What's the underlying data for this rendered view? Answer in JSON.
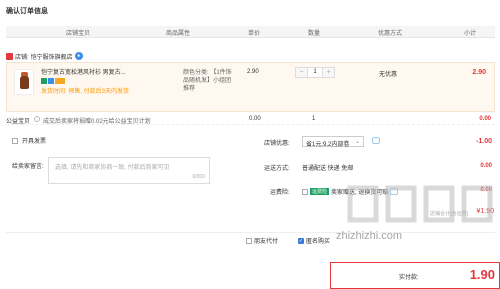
{
  "page_title": "确认订单信息",
  "table_headers": {
    "shop_item": "店铺宝贝",
    "attr": "商品属性",
    "unit_price": "单价",
    "qty": "数量",
    "discount": "优惠方式",
    "subtotal": "小计"
  },
  "shop": {
    "label": "店铺:",
    "name": "恺宁服饰旗舰店"
  },
  "item": {
    "name": "恺宁复古宽松港风衬衫 男复古",
    "name_cont": "...",
    "promo": "发货时间: 预售, 付款后3天内发货",
    "attr": "颜色分类: 【1件饰品随机发】小组团推荐",
    "price": "2.90",
    "qty": "1",
    "minus": "−",
    "plus": "+",
    "discount": "无优惠",
    "subtotal": "2.90"
  },
  "charity": {
    "label": "公益宝贝",
    "text": "成交后卖家将捐赠0.02元给公益宝贝计划",
    "price": "0.00",
    "qty": "1",
    "subtotal": "0.00"
  },
  "invoice_label": "开具发票",
  "message": {
    "label": "给卖家留言:",
    "placeholder": "选填, 请先和商家协商一致, 付款后商家可见",
    "counter": "0/200"
  },
  "store_discount": {
    "label": "店铺优惠:",
    "value": "省1元:9.2内部卷",
    "amount": "-1.00"
  },
  "shipping": {
    "label": "运送方式:",
    "value": "普通配送 快递 免邮",
    "amount": "0.00"
  },
  "insurance": {
    "label": "运费险:",
    "tag": "运费险",
    "value": "卖家赠送, 退换货可赔",
    "amount": "0.00"
  },
  "faded_line": "店铺合计(含运费)",
  "faded_amount": "¥1.90",
  "bottom": {
    "friend_pay": "朋友代付",
    "anonymous": "匿名购买"
  },
  "payment": {
    "label": "实付款:",
    "value": "1.90"
  },
  "watermark": "zhizhizhi.com"
}
